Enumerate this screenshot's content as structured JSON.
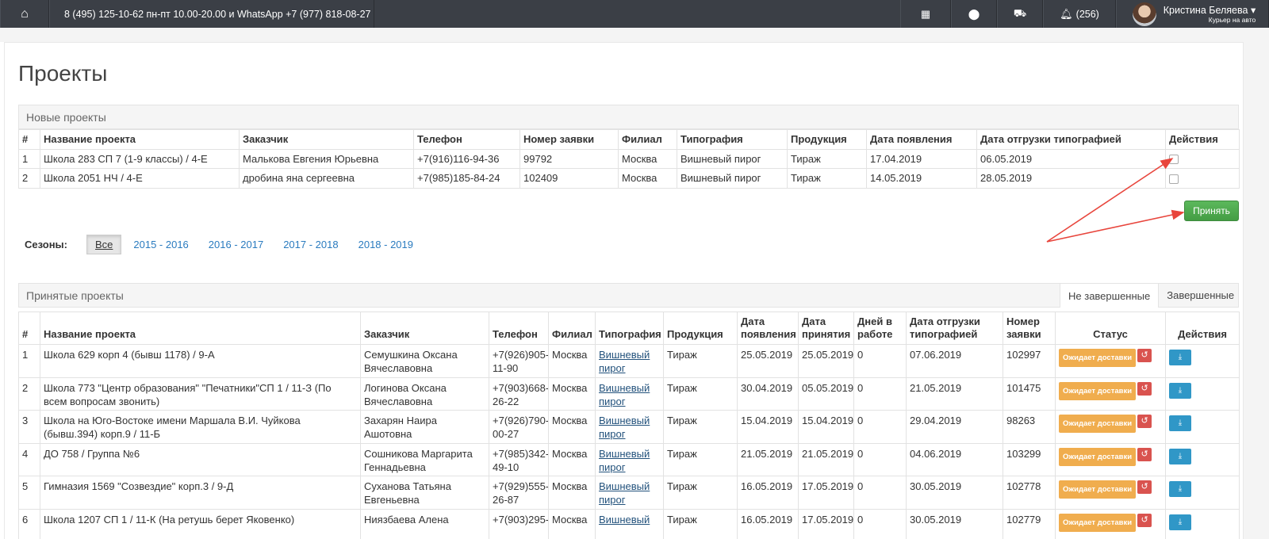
{
  "topbar": {
    "home_icon": "home-icon",
    "contact": "8 (495) 125-10-62 пн-пт 10.00-20.00 и WhatsApp +7 (977) 818-08-27",
    "notifications_count": "(256)",
    "user_name": "Кристина Беляева",
    "user_role": "Курьер на авто",
    "caret": "▾"
  },
  "page": {
    "title": "Проекты"
  },
  "new_projects": {
    "heading": "Новые проекты",
    "columns": [
      "#",
      "Название проекта",
      "Заказчик",
      "Телефон",
      "Номер заявки",
      "Филиал",
      "Типография",
      "Продукция",
      "Дата появления",
      "Дата отгрузки типографией",
      "Действия"
    ],
    "rows": [
      [
        "1",
        "Школа 283 СП 7 (1-9 классы) / 4-Е",
        "Малькова Евгения Юрьевна",
        "+7(916)116-94-36",
        "99792",
        "Москва",
        "Вишневый пирог",
        "Тираж",
        "17.04.2019",
        "06.05.2019"
      ],
      [
        "2",
        "Школа 2051 НЧ / 4-Е",
        "дробина яна сергеевна",
        "+7(985)185-84-24",
        "102409",
        "Москва",
        "Вишневый пирог",
        "Тираж",
        "14.05.2019",
        "28.05.2019"
      ]
    ],
    "accept_label": "Принять"
  },
  "seasons": {
    "label": "Сезоны:",
    "items": [
      "Все",
      "2015 - 2016",
      "2016 - 2017",
      "2017 - 2018",
      "2018 - 2019"
    ],
    "active": "Все"
  },
  "accepted_projects": {
    "heading": "Принятые проекты",
    "tabs": [
      "Не завершенные",
      "Завершенные"
    ],
    "active_tab": "Не завершенные",
    "columns": [
      "#",
      "Название проекта",
      "Заказчик",
      "Телефон",
      "Филиал",
      "Типография",
      "Продукция",
      "Дата появления",
      "Дата принятия",
      "Дней в работе",
      "Дата отгрузки типографией",
      "Номер заявки",
      "Статус",
      "Действия"
    ],
    "status_label": "Ожидает доставки",
    "rows": [
      [
        "1",
        "Школа 629 корп 4 (бывш 1178) / 9-А",
        "Семушкина Оксана Вячеславовна",
        "+7(926)905-11-90",
        "Москва",
        "Вишневый пирог",
        "Тираж",
        "25.05.2019",
        "25.05.2019",
        "0",
        "07.06.2019",
        "102997"
      ],
      [
        "2",
        "Школа 773 \"Центр образования\" \"Печатники\"СП 1 / 11-З (По всем вопросам звонить)",
        "Логинова Оксана Вячеславовна",
        "+7(903)668-26-22",
        "Москва",
        "Вишневый пирог",
        "Тираж",
        "30.04.2019",
        "05.05.2019",
        "0",
        "21.05.2019",
        "101475"
      ],
      [
        "3",
        "Школа на Юго-Востоке имени Маршала В.И. Чуйкова (бывш.394) корп.9 / 11-Б",
        "Захарян Наира Ашотовна",
        "+7(926)790-00-27",
        "Москва",
        "Вишневый пирог",
        "Тираж",
        "15.04.2019",
        "15.04.2019",
        "0",
        "29.04.2019",
        "98263"
      ],
      [
        "4",
        "ДО 758 / Группа №6",
        "Сошникова Маргарита Геннадьевна",
        "+7(985)342-49-10",
        "Москва",
        "Вишневый пирог",
        "Тираж",
        "21.05.2019",
        "21.05.2019",
        "0",
        "04.06.2019",
        "103299"
      ],
      [
        "5",
        "Гимназия 1569 \"Созвездие\" корп.3 / 9-Д",
        "Суханова Татьяна Евгеньевна",
        "+7(929)555-26-87",
        "Москва",
        "Вишневый пирог",
        "Тираж",
        "16.05.2019",
        "17.05.2019",
        "0",
        "30.05.2019",
        "102778"
      ],
      [
        "6",
        "Школа 1207 СП 1 / 11-К (На ретушь берет Яковенко)",
        "Ниязбаева Алена",
        "+7(903)295-",
        "Москва",
        "Вишневый",
        "Тираж",
        "16.05.2019",
        "17.05.2019",
        "0",
        "30.05.2019",
        "102779"
      ]
    ]
  },
  "colors": {
    "topbar": "#3b3f46",
    "accept": "#5cb85c",
    "status": "#f0ad4e",
    "revert": "#d9534f",
    "download": "#3097c7",
    "arrow": "#e8453c"
  }
}
